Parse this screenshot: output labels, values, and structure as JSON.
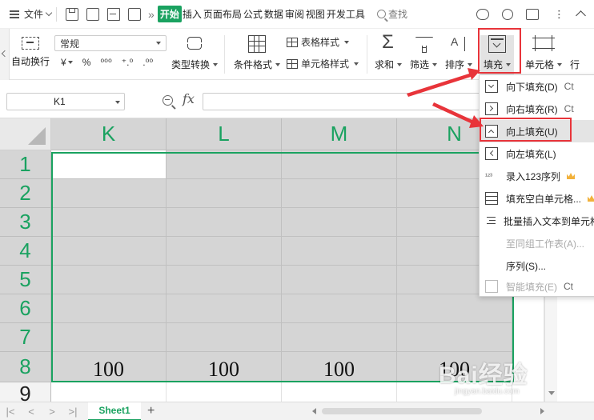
{
  "menubar": {
    "file_label": "文件",
    "tabs": [
      "开始",
      "插入",
      "页面布局",
      "公式",
      "数据",
      "审阅",
      "视图",
      "开发工具"
    ],
    "search_label": "查找"
  },
  "ribbon": {
    "wrap_label": "自动换行",
    "number_format": "常规",
    "format_symbols": [
      "¥",
      "%",
      "⁰⁰⁰",
      "⁺.⁰",
      ".⁰⁰"
    ],
    "type_convert_label": "类型转换",
    "conditional_format_label": "条件格式",
    "table_style_label": "表格样式",
    "cell_style_label": "单元格样式",
    "sum_label": "求和",
    "filter_label": "筛选",
    "sort_label": "排序",
    "fill_label": "填充",
    "cell_label": "单元格",
    "row_label": "行"
  },
  "formula_bar": {
    "name_box": "K1",
    "fx_label": "fx"
  },
  "sheet": {
    "columns": [
      "K",
      "L",
      "M",
      "N"
    ],
    "rows": [
      "1",
      "2",
      "3",
      "4",
      "5",
      "6",
      "7",
      "8",
      "9"
    ],
    "row8_values": [
      "100",
      "100",
      "100",
      "100"
    ],
    "tab_name": "Sheet1",
    "add_sheet": "+"
  },
  "fill_menu": {
    "items": [
      {
        "label": "向下填充(D)",
        "shortcut": "Ct",
        "icon": "fill-down-icon"
      },
      {
        "label": "向右填充(R)",
        "shortcut": "Ct",
        "icon": "fill-right-icon"
      },
      {
        "label": "向上填充(U)",
        "shortcut": "",
        "icon": "fill-up-icon"
      },
      {
        "label": "向左填充(L)",
        "shortcut": "",
        "icon": "fill-left-icon"
      },
      {
        "label": "录入123序列",
        "shortcut": "",
        "icon": "sequence-123-icon"
      },
      {
        "label": "填充空白单元格...",
        "shortcut": "",
        "icon": "fill-blank-icon"
      },
      {
        "label": "批量插入文本到单元格",
        "shortcut": "",
        "icon": "batch-insert-icon"
      },
      {
        "label": "至同组工作表(A)...",
        "shortcut": "",
        "icon": ""
      },
      {
        "label": "序列(S)...",
        "shortcut": "",
        "icon": ""
      },
      {
        "label": "智能填充(E)",
        "shortcut": "Ct",
        "icon": "smart-fill-icon"
      }
    ]
  },
  "watermark": {
    "brand": "Bai经验",
    "url": "jingyan.baidu.com"
  },
  "colors": {
    "accent_green": "#1aa260",
    "highlight_red": "#e8343a",
    "selection_gray": "#d5d5d5"
  }
}
